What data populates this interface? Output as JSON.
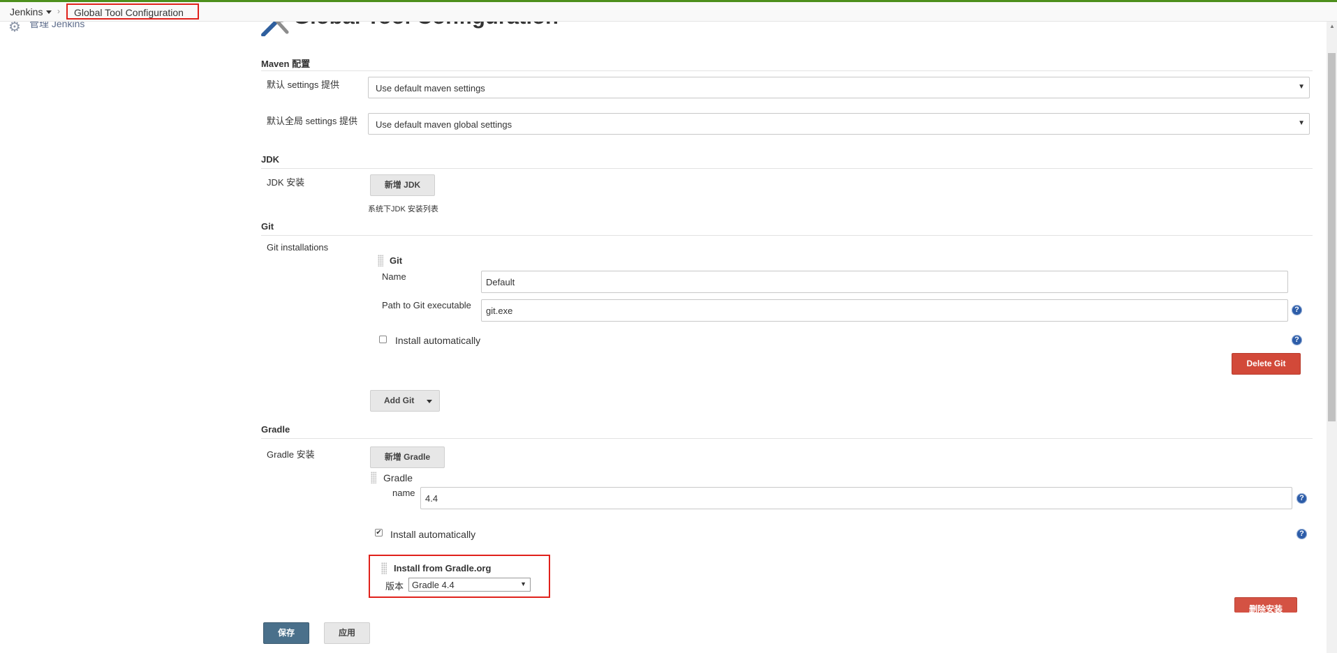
{
  "breadcrumb": {
    "root": "Jenkins",
    "separator": "›",
    "current": "Global Tool Configuration"
  },
  "sidebar": {
    "manage_label": "管理 Jenkins"
  },
  "page": {
    "title": "Global Tool Configuration"
  },
  "maven": {
    "heading": "Maven 配置",
    "settings_label": "默认 settings 提供",
    "settings_value": "Use default maven settings",
    "global_settings_label": "默认全局 settings 提供",
    "global_settings_value": "Use default maven global settings"
  },
  "jdk": {
    "heading": "JDK",
    "install_label": "JDK 安装",
    "add_button": "新增 JDK",
    "note": "系统下JDK 安装列表"
  },
  "git": {
    "heading": "Git",
    "installations_label": "Git installations",
    "item_title": "Git",
    "name_label": "Name",
    "name_value": "Default",
    "path_label": "Path to Git executable",
    "path_value": "git.exe",
    "install_auto_label": "Install automatically",
    "install_auto_checked": false,
    "delete_button": "Delete Git",
    "add_button": "Add Git"
  },
  "gradle": {
    "heading": "Gradle",
    "install_label": "Gradle 安装",
    "add_button": "新增 Gradle",
    "item_title": "Gradle",
    "name_label": "name",
    "name_value": "4.4",
    "install_auto_label": "Install automatically",
    "install_auto_checked": true,
    "installer_title": "Install from Gradle.org",
    "version_label": "版本",
    "version_value": "Gradle 4.4",
    "delete_installer_button": "删除安装"
  },
  "footer": {
    "save_button": "保存",
    "apply_button": "应用"
  },
  "icons": {
    "help": "?",
    "dropdown": "▼",
    "check": "✔"
  },
  "colors": {
    "header_accent": "#4d8f1c",
    "highlight": "#e0211b",
    "delete_red": "#d24939",
    "save_blue": "#4a708b",
    "help_blue": "#2c5ca8"
  }
}
